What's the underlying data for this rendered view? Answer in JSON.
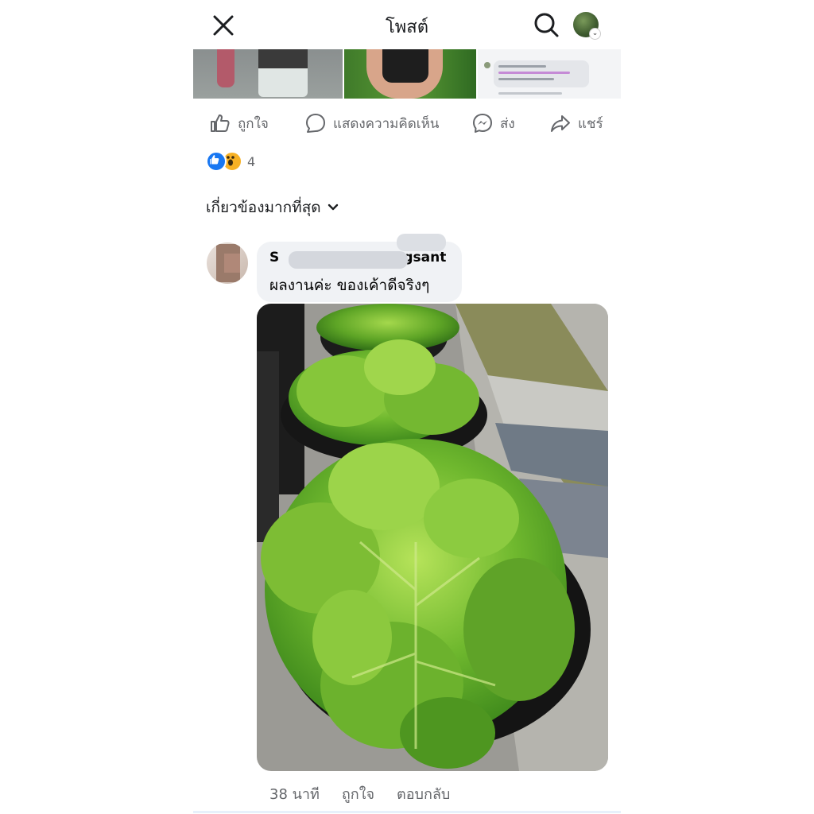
{
  "header": {
    "title": "โพสต์",
    "close_icon": "close-icon",
    "search_icon": "search-icon"
  },
  "actions": {
    "like": "ถูกใจ",
    "comment": "แสดงความคิดเห็น",
    "send": "ส่ง",
    "share": "แชร์"
  },
  "reactions": {
    "count": "4",
    "icons": [
      "like-icon",
      "wow-icon"
    ]
  },
  "sort": {
    "label": "เกี่ยวข้องมากที่สุด"
  },
  "comment": {
    "author_start": "S",
    "author_end": "ngsant",
    "text": "ผลงานค่ะ ของเค้าดีจริงๆ",
    "time": "38 นาที",
    "like": "ถูกใจ",
    "reply": "ตอบกลับ"
  },
  "colors": {
    "accent": "#1877f2",
    "text_secondary": "#65676b",
    "bubble": "#f0f2f5"
  }
}
